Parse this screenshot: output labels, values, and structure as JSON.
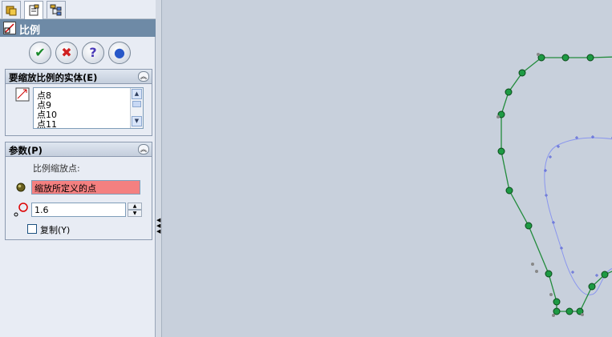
{
  "panel": {
    "title": "比例",
    "tabs": [
      "feature-manager",
      "property-manager",
      "configuration-manager"
    ],
    "actions": {
      "ok_icon": "check-icon",
      "cancel_icon": "x-icon",
      "help_icon": "question-icon",
      "detail_icon": "pushpin-icon"
    },
    "entities_group": {
      "title": "要缩放比例的实体(E)",
      "items": [
        "点8",
        "点9",
        "点10",
        "点11"
      ]
    },
    "params_group": {
      "title": "参数(P)",
      "scale_point_label": "比例缩放点:",
      "scale_point_value": "缩放所定义的点",
      "scale_factor": "1.6",
      "copy_label": "复制(Y)",
      "copy_checked": false
    }
  },
  "colors": {
    "title_bar": "#6e8aa6",
    "outer_profile": "#228b3c",
    "inner_profile": "#8a96ee",
    "point_fill": "#1e9a44",
    "highlight_field": "#f48080"
  }
}
